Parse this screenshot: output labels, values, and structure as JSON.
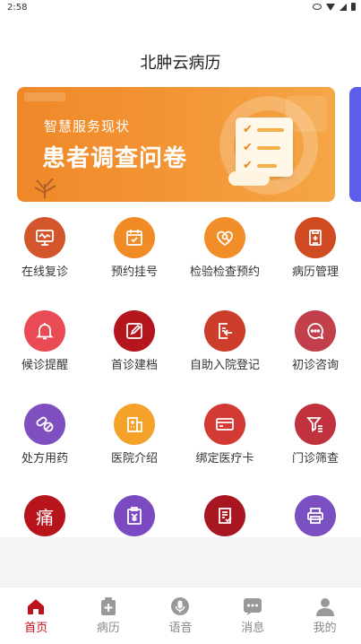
{
  "status_bar": {
    "time": "2:58"
  },
  "app_title": "北肿云病历",
  "banner": {
    "subtitle": "智慧服务现状",
    "title": "患者调查问卷"
  },
  "features": [
    {
      "label": "在线复诊",
      "icon": "monitor-icon",
      "color": "#d2552b"
    },
    {
      "label": "预约挂号",
      "icon": "calendar-check-icon",
      "color": "#f08b26"
    },
    {
      "label": "检验检查预约",
      "icon": "search-heart-icon",
      "color": "#f28e29"
    },
    {
      "label": "病历管理",
      "icon": "clipboard-icon",
      "color": "#d14b22"
    },
    {
      "label": "候诊提醒",
      "icon": "bell-icon",
      "color": "#ea4a54"
    },
    {
      "label": "首诊建档",
      "icon": "edit-icon",
      "color": "#b5161e"
    },
    {
      "label": "自助入院登记",
      "icon": "checkin-icon",
      "color": "#cc3e2a"
    },
    {
      "label": "初诊咨询",
      "icon": "chat-icon",
      "color": "#c23f4c"
    },
    {
      "label": "处方用药",
      "icon": "pill-icon",
      "color": "#7f4fc0"
    },
    {
      "label": "医院介绍",
      "icon": "hospital-icon",
      "color": "#f4a22a"
    },
    {
      "label": "绑定医疗卡",
      "icon": "card-icon",
      "color": "#d33a33"
    },
    {
      "label": "门诊筛查",
      "icon": "filter-icon",
      "color": "#c2323e"
    },
    {
      "label": "",
      "icon": "pain-icon",
      "icon_text": "痛",
      "color": "#b8141c"
    },
    {
      "label": "",
      "icon": "bill-icon",
      "color": "#7b4ac0"
    },
    {
      "label": "",
      "icon": "report-icon",
      "color": "#a81622"
    },
    {
      "label": "",
      "icon": "printer-icon",
      "color": "#7a4fc2"
    }
  ],
  "tabs": [
    {
      "label": "首页",
      "icon": "home-icon",
      "active": true
    },
    {
      "label": "病历",
      "icon": "medical-record-icon",
      "active": false
    },
    {
      "label": "语音",
      "icon": "microphone-icon",
      "active": false
    },
    {
      "label": "消息",
      "icon": "message-icon",
      "active": false
    },
    {
      "label": "我的",
      "icon": "user-icon",
      "active": false
    }
  ],
  "colors": {
    "accent": "#c0121a",
    "banner": "#f08828",
    "inactive_tab": "#888888"
  }
}
